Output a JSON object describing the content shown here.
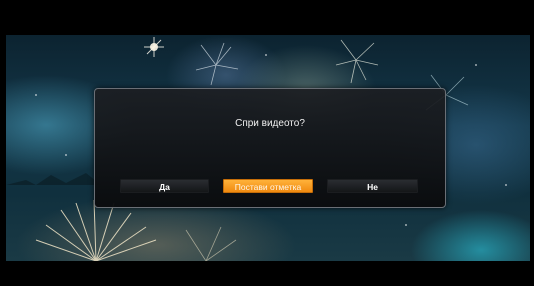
{
  "dialog": {
    "question": "Спри видеото?",
    "buttons": {
      "yes_label": "Да",
      "mark_label": "Постави отметка",
      "no_label": "Не"
    },
    "selected": "mark"
  },
  "colors": {
    "selected_button": "#f59a1f",
    "dialog_background": "#121315",
    "letterbox": "#000000"
  }
}
